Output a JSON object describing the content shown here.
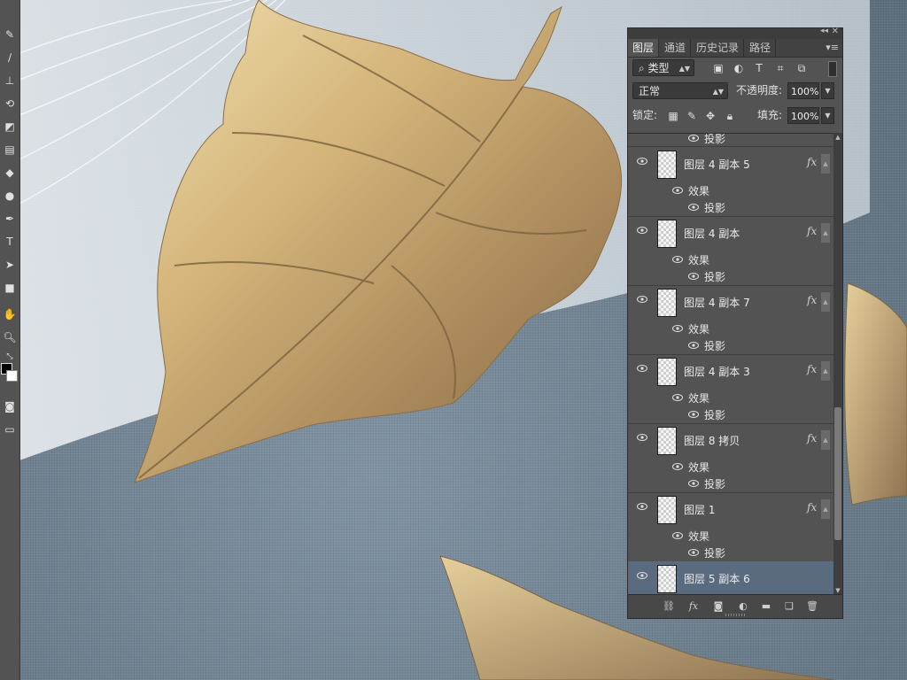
{
  "panel": {
    "tabs": [
      {
        "label": "图层",
        "active": true
      },
      {
        "label": "通道",
        "active": false
      },
      {
        "label": "历史记录",
        "active": false
      },
      {
        "label": "路径",
        "active": false
      }
    ],
    "filter": {
      "label": "类型"
    },
    "blend_mode": "正常",
    "opacity_label": "不透明度:",
    "opacity_value": "100%",
    "lock_label": "锁定:",
    "fill_label": "填充:",
    "fill_value": "100%",
    "top_partial_sub": "投影",
    "layers": [
      {
        "name": "图层 4 副本 5",
        "effects_label": "效果",
        "effect": "投影",
        "fx": "fx"
      },
      {
        "name": "图层 4 副本",
        "effects_label": "效果",
        "effect": "投影",
        "fx": "fx"
      },
      {
        "name": "图层 4 副本 7",
        "effects_label": "效果",
        "effect": "投影",
        "fx": "fx"
      },
      {
        "name": "图层 4 副本 3",
        "effects_label": "效果",
        "effect": "投影",
        "fx": "fx"
      },
      {
        "name": "图层 8 拷贝",
        "effects_label": "效果",
        "effect": "投影",
        "fx": "fx"
      },
      {
        "name": "图层 1",
        "effects_label": "效果",
        "effect": "投影",
        "fx": "fx"
      },
      {
        "name": "图层 5 副本 6",
        "selected": true
      }
    ],
    "bottom_icons": [
      "link-icon",
      "fx-icon",
      "mask-icon",
      "adjustment-icon",
      "folder-icon",
      "new-layer-icon",
      "trash-icon"
    ]
  },
  "colors": {
    "panel_bg": "#535353",
    "selected_layer": "#5a6a7f",
    "canvas_bg": "#6f7f8d",
    "leaf_gold": "#c9a768"
  }
}
